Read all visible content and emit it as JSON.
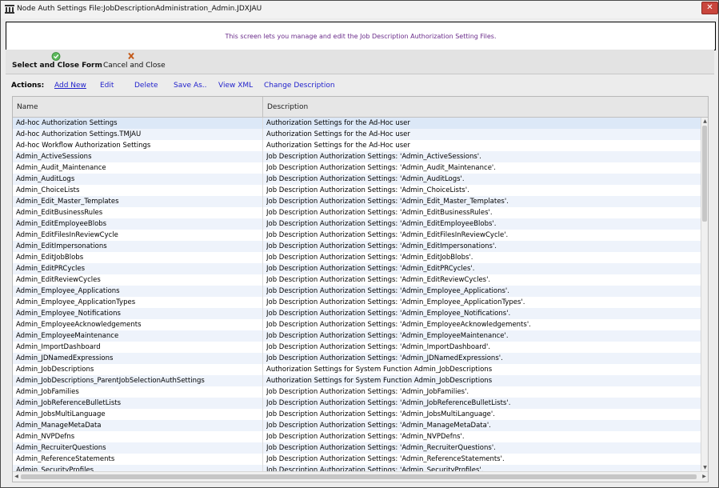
{
  "window": {
    "title": "Node Auth Settings File:JobDescriptionAdministration_Admin.JDXJAU",
    "close_label": "✕"
  },
  "banner": {
    "text": "This screen lets you manage and edit the Job Description Authorization Setting Files."
  },
  "toolbar": {
    "select_close_label": "Select and Close Form",
    "cancel_close_label": "Cancel and Close"
  },
  "actions": {
    "label": "Actions:",
    "add_new": "Add New",
    "edit": "Edit",
    "delete": "Delete",
    "save_as": "Save As..",
    "view_xml": "View XML",
    "change_description": "Change Description"
  },
  "grid": {
    "col_name": "Name",
    "col_description": "Description",
    "rows": [
      {
        "name": "Ad-hoc Authorization Settings",
        "description": "Authorization Settings for the Ad-Hoc user"
      },
      {
        "name": "Ad-hoc Authorization Settings.TMJAU",
        "description": "Authorization Settings for the Ad-Hoc user"
      },
      {
        "name": "Ad-hoc Workflow Authorization Settings",
        "description": "Authorization Settings for the Ad-Hoc user"
      },
      {
        "name": "Admin_ActiveSessions",
        "description": "Job Description Authorization Settings: 'Admin_ActiveSessions'."
      },
      {
        "name": "Admin_Audit_Maintenance",
        "description": "Job Description Authorization Settings: 'Admin_Audit_Maintenance'."
      },
      {
        "name": "Admin_AuditLogs",
        "description": "Job Description Authorization Settings: 'Admin_AuditLogs'."
      },
      {
        "name": "Admin_ChoiceLists",
        "description": "Job Description Authorization Settings: 'Admin_ChoiceLists'."
      },
      {
        "name": "Admin_Edit_Master_Templates",
        "description": "Job Description Authorization Settings: 'Admin_Edit_Master_Templates'."
      },
      {
        "name": "Admin_EditBusinessRules",
        "description": "Job Description Authorization Settings: 'Admin_EditBusinessRules'."
      },
      {
        "name": "Admin_EditEmployeeBlobs",
        "description": "Job Description Authorization Settings: 'Admin_EditEmployeeBlobs'."
      },
      {
        "name": "Admin_EditFilesInReviewCycle",
        "description": "Job Description Authorization Settings: 'Admin_EditFilesInReviewCycle'."
      },
      {
        "name": "Admin_EditImpersonations",
        "description": "Job Description Authorization Settings: 'Admin_EditImpersonations'."
      },
      {
        "name": "Admin_EditJobBlobs",
        "description": "Job Description Authorization Settings: 'Admin_EditJobBlobs'."
      },
      {
        "name": "Admin_EditPRCycles",
        "description": "Job Description Authorization Settings: 'Admin_EditPRCycles'."
      },
      {
        "name": "Admin_EditReviewCycles",
        "description": "Job Description Authorization Settings: 'Admin_EditReviewCycles'."
      },
      {
        "name": "Admin_Employee_Applications",
        "description": "Job Description Authorization Settings: 'Admin_Employee_Applications'."
      },
      {
        "name": "Admin_Employee_ApplicationTypes",
        "description": "Job Description Authorization Settings: 'Admin_Employee_ApplicationTypes'."
      },
      {
        "name": "Admin_Employee_Notifications",
        "description": "Job Description Authorization Settings: 'Admin_Employee_Notifications'."
      },
      {
        "name": "Admin_EmployeeAcknowledgements",
        "description": "Job Description Authorization Settings: 'Admin_EmployeeAcknowledgements'."
      },
      {
        "name": "Admin_EmployeeMaintenance",
        "description": "Job Description Authorization Settings: 'Admin_EmployeeMaintenance'."
      },
      {
        "name": "Admin_ImportDashboard",
        "description": "Job Description Authorization Settings: 'Admin_ImportDashboard'."
      },
      {
        "name": "Admin_JDNamedExpressions",
        "description": "Job Description Authorization Settings: 'Admin_JDNamedExpressions'."
      },
      {
        "name": "Admin_JobDescriptions",
        "description": "Authorization Settings for System Function Admin_JobDescriptions"
      },
      {
        "name": "Admin_JobDescriptions_ParentJobSelectionAuthSettings",
        "description": "Authorization Settings for System Function Admin_JobDescriptions"
      },
      {
        "name": "Admin_JobFamilies",
        "description": "Job Description Authorization Settings: 'Admin_JobFamilies'."
      },
      {
        "name": "Admin_JobReferenceBulletLists",
        "description": "Job Description Authorization Settings: 'Admin_JobReferenceBulletLists'."
      },
      {
        "name": "Admin_JobsMultiLanguage",
        "description": "Job Description Authorization Settings: 'Admin_JobsMultiLanguage'."
      },
      {
        "name": "Admin_ManageMetaData",
        "description": "Job Description Authorization Settings: 'Admin_ManageMetaData'."
      },
      {
        "name": "Admin_NVPDefns",
        "description": "Job Description Authorization Settings: 'Admin_NVPDefns'."
      },
      {
        "name": "Admin_RecruiterQuestions",
        "description": "Job Description Authorization Settings: 'Admin_RecruiterQuestions'."
      },
      {
        "name": "Admin_ReferenceStatements",
        "description": "Job Description Authorization Settings: 'Admin_ReferenceStatements'."
      },
      {
        "name": "Admin_SecurityProfiles",
        "description": "Job Description Authorization Settings: 'Admin_SecurityProfiles'."
      }
    ]
  }
}
